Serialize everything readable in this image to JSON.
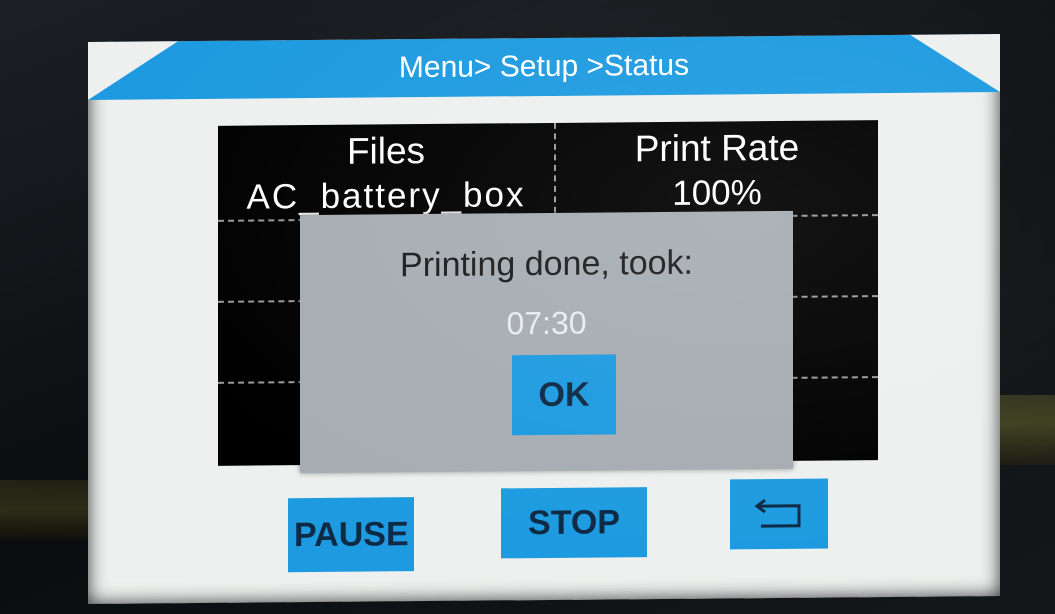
{
  "header": {
    "breadcrumb": "Menu> Setup >Status"
  },
  "status_table": {
    "files_label": "Files",
    "file_name": "AC_battery_box",
    "print_rate_label": "Print Rate",
    "print_rate_value": "100%"
  },
  "dialog": {
    "message": "Printing done, took:",
    "elapsed_time": "07:30",
    "ok_label": "OK"
  },
  "controls": {
    "pause_label": "PAUSE",
    "stop_label": "STOP",
    "back_icon": "return-arrow-icon"
  },
  "colors": {
    "accent": "#1e9be0",
    "dialog_bg": "#a6adb3",
    "table_bg": "#000000"
  }
}
